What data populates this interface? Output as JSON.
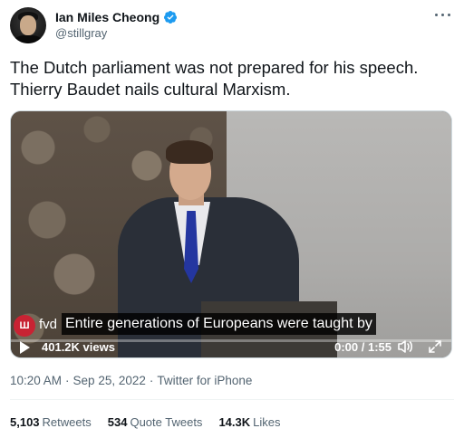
{
  "user": {
    "display_name": "Ian Miles Cheong",
    "handle": "@stillgray",
    "verified_icon": "verified-badge-icon"
  },
  "tweet": {
    "text_line1": "The Dutch parliament was not prepared for his speech.",
    "text_line2": "Thierry Baudet nails cultural Marxism."
  },
  "video": {
    "channel_tag": "fvd",
    "caption": "Entire generations of Europeans were taught by",
    "views": "401.2K views",
    "time": "0:00 / 1:55",
    "progress": 0.0
  },
  "meta": {
    "time": "10:20 AM",
    "sep1": "·",
    "date": "Sep 25, 2022",
    "sep2": "·",
    "source": "Twitter for iPhone"
  },
  "stats": {
    "retweets_num": "5,103",
    "retweets_label": "Retweets",
    "quotes_num": "534",
    "quotes_label": "Quote Tweets",
    "likes_num": "14.3K",
    "likes_label": "Likes"
  },
  "colors": {
    "accent": "#1d9bf0",
    "text_primary": "#0f1419",
    "text_secondary": "#536471"
  }
}
